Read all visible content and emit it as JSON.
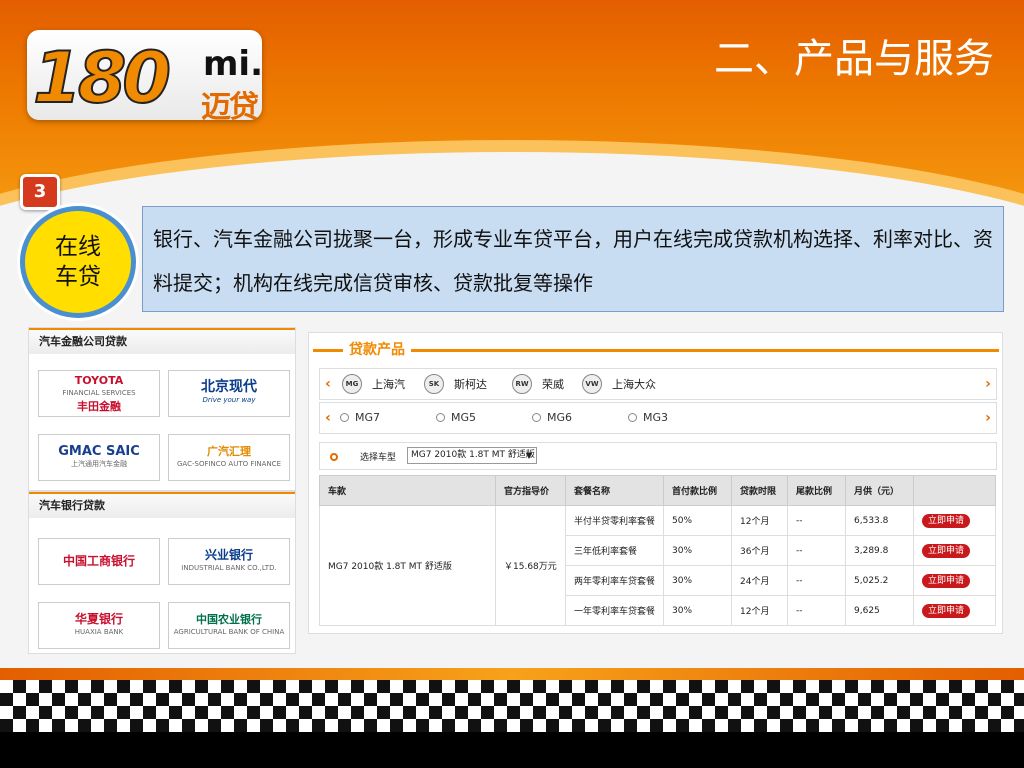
{
  "header": {
    "logo_number": "180",
    "logo_mi": "mi.",
    "logo_cn": "迈贷",
    "title": "二、产品与服务"
  },
  "section": {
    "badge": "3",
    "circle_line1": "在线",
    "circle_line2": "车贷",
    "description": "银行、汽车金融公司拢聚一台，形成专业车贷平台，用户在线完成贷款机构选择、利率对比、资料提交；机构在线完成信贷审核、贷款批复等操作"
  },
  "finance_panel": {
    "title": "汽车金融公司贷款",
    "tiles": [
      {
        "name": "TOYOTA",
        "sub": "FINANCIAL SERVICES",
        "cn": "丰田金融"
      },
      {
        "name": "北京现代",
        "sub": "Drive your way"
      },
      {
        "name": "GMAC SAIC",
        "cn": "上汽通用汽车金融"
      },
      {
        "name": "广汽汇理",
        "sub": "GAC-SOFINCO AUTO FINANCE"
      }
    ]
  },
  "bank_panel": {
    "title": "汽车银行贷款",
    "tiles": [
      {
        "name": "中国工商银行"
      },
      {
        "name": "兴业银行",
        "sub": "INDUSTRIAL BANK CO.,LTD."
      },
      {
        "name": "华夏银行",
        "sub": "HUAXIA BANK"
      },
      {
        "name": "中国农业银行",
        "sub": "AGRICULTURAL BANK OF CHINA"
      }
    ]
  },
  "loan": {
    "title": "贷款产品",
    "brands": [
      "上海汽",
      "斯柯达",
      "荣威",
      "上海大众"
    ],
    "brand_icons": [
      "MG",
      "SK",
      "RW",
      "VW"
    ],
    "models": [
      "MG7",
      "MG5",
      "MG6",
      "MG3"
    ],
    "select_label": "选择车型",
    "selected_model": "MG7 2010款 1.8T MT 舒适版",
    "columns": [
      "车款",
      "官方指导价",
      "套餐名称",
      "首付款比例",
      "贷款时限",
      "尾款比例",
      "月供（元）"
    ],
    "car": "MG7 2010款 1.8T MT 舒适版",
    "price": "￥15.68万元",
    "rows": [
      {
        "package": "半付半贷零利率套餐",
        "down": "50%",
        "term": "12个月",
        "balloon": "--",
        "monthly": "6,533.8"
      },
      {
        "package": "三年低利率套餐",
        "down": "30%",
        "term": "36个月",
        "balloon": "--",
        "monthly": "3,289.8"
      },
      {
        "package": "两年零利率车贷套餐",
        "down": "30%",
        "term": "24个月",
        "balloon": "--",
        "monthly": "5,025.2"
      },
      {
        "package": "一年零利率车贷套餐",
        "down": "30%",
        "term": "12个月",
        "balloon": "--",
        "monthly": "9,625"
      }
    ],
    "apply_label": "立即申请"
  }
}
